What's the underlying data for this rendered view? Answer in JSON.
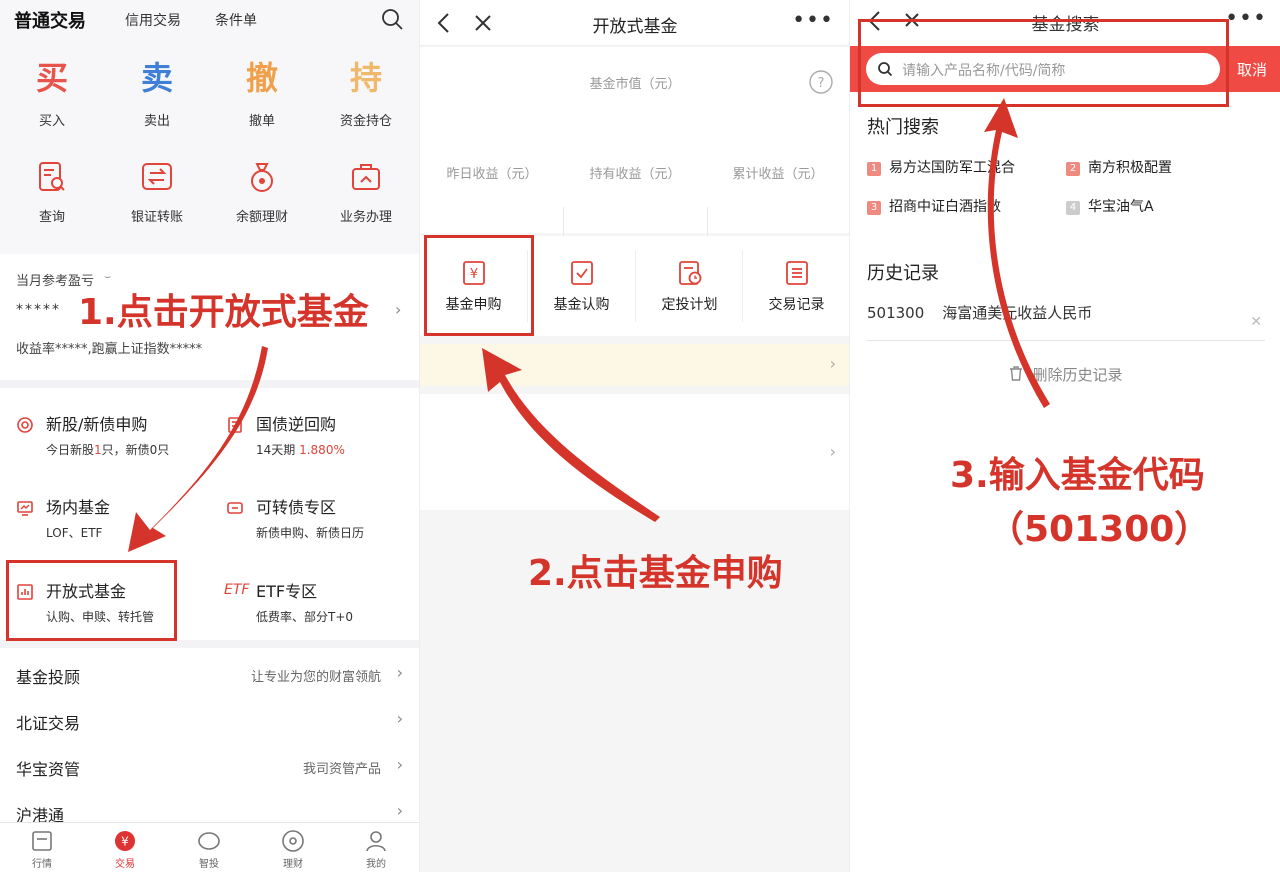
{
  "panel1": {
    "tabs": [
      "普通交易",
      "信用交易",
      "条件单"
    ],
    "big_actions": [
      {
        "glyph": "买",
        "label": "买入",
        "color": "#e8534c"
      },
      {
        "glyph": "卖",
        "label": "卖出",
        "color": "#3f7fd6"
      },
      {
        "glyph": "撤",
        "label": "撤单",
        "color": "#f0a04b"
      },
      {
        "glyph": "持",
        "label": "资金持仓",
        "color": "#f0b86a"
      }
    ],
    "small_actions": [
      {
        "label": "查询",
        "icon": "search-doc-icon"
      },
      {
        "label": "银证转账",
        "icon": "transfer-icon"
      },
      {
        "label": "余额理财",
        "icon": "money-bag-icon"
      },
      {
        "label": "业务办理",
        "icon": "briefcase-icon"
      }
    ],
    "profit": {
      "label": "当月参考盈亏",
      "masked_value": "*****",
      "note": "收益率*****,跑赢上证指数*****"
    },
    "services": [
      {
        "title": "新股/新债申购",
        "sub_prefix": "今日新股",
        "sub_hl": "1",
        "sub_suffix": "只，新债0只"
      },
      {
        "title": "国债逆回购",
        "sub_prefix": "14天期 ",
        "sub_hl": "1.880%",
        "sub_suffix": ""
      },
      {
        "title": "场内基金",
        "sub": "LOF、ETF"
      },
      {
        "title": "可转债专区",
        "sub": "新债申购、新债日历"
      },
      {
        "title": "开放式基金",
        "sub": "认购、申赎、转托管"
      },
      {
        "title": "ETF专区",
        "sub": "低费率、部分T+0",
        "icon_text": "ETF"
      }
    ],
    "rows": [
      {
        "title": "基金投顾",
        "right": "让专业为您的财富领航"
      },
      {
        "title": "北证交易",
        "right": ""
      },
      {
        "title": "华宝资管",
        "right": "我司资管产品"
      },
      {
        "title": "沪港通",
        "right": ""
      }
    ],
    "tabbar": [
      {
        "label": "行情",
        "icon": "chart-icon"
      },
      {
        "label": "交易",
        "icon": "yuan-icon"
      },
      {
        "label": "智投",
        "icon": "brain-icon"
      },
      {
        "label": "理财",
        "icon": "coin-icon"
      },
      {
        "label": "我的",
        "icon": "person-icon"
      }
    ]
  },
  "panel2": {
    "title": "开放式基金",
    "market_value_label": "基金市值（元）",
    "stats": [
      "昨日收益（元）",
      "持有收益（元）",
      "累计收益（元）"
    ],
    "actions": [
      {
        "label": "基金申购",
        "icon": "yuan-doc-icon"
      },
      {
        "label": "基金认购",
        "icon": "check-doc-icon"
      },
      {
        "label": "定投计划",
        "icon": "clock-doc-icon"
      },
      {
        "label": "交易记录",
        "icon": "list-doc-icon"
      }
    ]
  },
  "panel3": {
    "title": "基金搜索",
    "search_placeholder": "请输入产品名称/代码/简称",
    "cancel": "取消",
    "hot_title": "热门搜索",
    "hot": [
      {
        "n": "1",
        "name": "易方达国防军工混合",
        "color": "#f08a80"
      },
      {
        "n": "2",
        "name": "南方积极配置",
        "color": "#f08a80"
      },
      {
        "n": "3",
        "name": "招商中证白酒指数",
        "color": "#f08a80"
      },
      {
        "n": "4",
        "name": "华宝油气A",
        "color": "#cccccc"
      }
    ],
    "history_title": "历史记录",
    "history": [
      {
        "code": "501300",
        "name": "海富通美元收益人民币"
      }
    ],
    "delete_history": "删除历史记录"
  },
  "annotations": {
    "step1": "1.点击开放式基金",
    "step2": "2.点击基金申购",
    "step3_line1": "3.输入基金代码",
    "step3_line2": "（501300）"
  },
  "colors": {
    "accent_red": "#d4342a",
    "search_bar": "#ef4b44"
  }
}
